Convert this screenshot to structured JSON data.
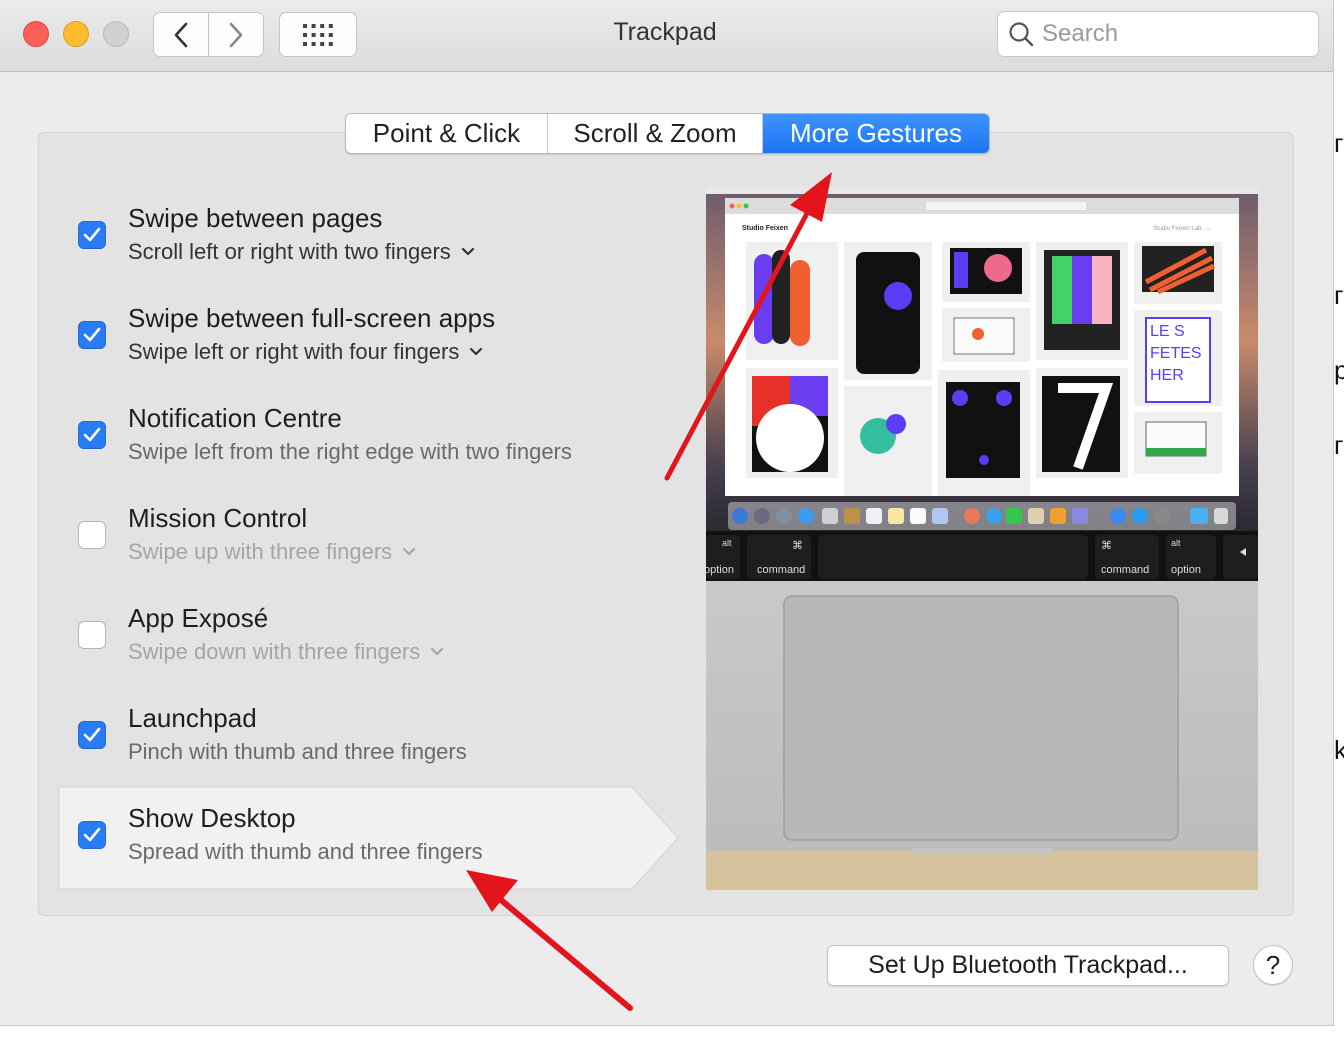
{
  "window": {
    "title": "Trackpad",
    "search_placeholder": "Search"
  },
  "tabs": [
    {
      "label": "Point & Click",
      "active": false
    },
    {
      "label": "Scroll & Zoom",
      "active": false
    },
    {
      "label": "More Gestures",
      "active": true
    }
  ],
  "gestures": [
    {
      "title": "Swipe between pages",
      "subtitle": "Scroll left or right with two fingers",
      "checked": true,
      "has_menu": true
    },
    {
      "title": "Swipe between full-screen apps",
      "subtitle": "Swipe left or right with four fingers",
      "checked": true,
      "has_menu": true
    },
    {
      "title": "Notification Centre",
      "subtitle": "Swipe left from the right edge with two fingers",
      "checked": true,
      "has_menu": false
    },
    {
      "title": "Mission Control",
      "subtitle": "Swipe up with three fingers",
      "checked": false,
      "has_menu": true
    },
    {
      "title": "App Exposé",
      "subtitle": "Swipe down with three fingers",
      "checked": false,
      "has_menu": true
    },
    {
      "title": "Launchpad",
      "subtitle": "Pinch with thumb and three fingers",
      "checked": true,
      "has_menu": false
    },
    {
      "title": "Show Desktop",
      "subtitle": "Spread with thumb and three fingers",
      "checked": true,
      "has_menu": false,
      "selected": true
    }
  ],
  "preview": {
    "site_name": "Studio Feixen",
    "site_link": "Studio Feixen Lab. →",
    "keys": [
      "alt",
      "option",
      "command",
      "command",
      "alt",
      "option"
    ]
  },
  "footer": {
    "bluetooth_button": "Set Up Bluetooth Trackpad...",
    "help_button": "?"
  },
  "colors": {
    "accent": "#2a7cf4",
    "annotation_arrow": "#e3141b"
  }
}
